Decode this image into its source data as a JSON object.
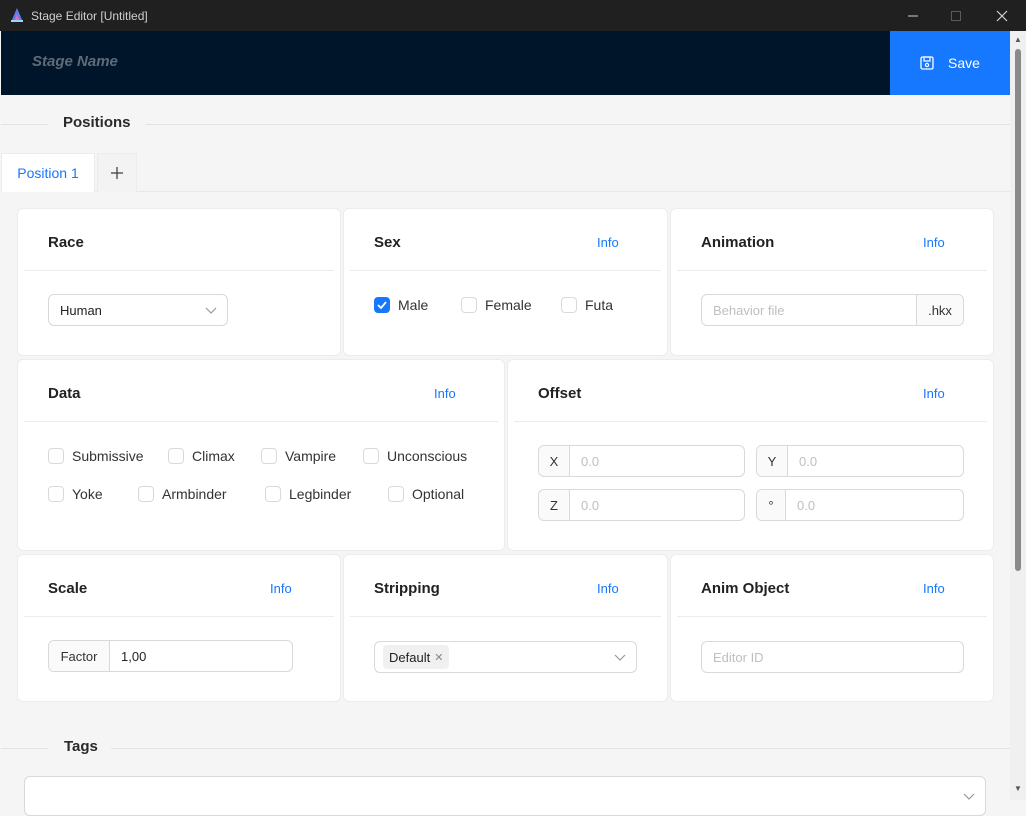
{
  "window": {
    "title": "Stage Editor [Untitled]",
    "minimize": "—",
    "maximize": "□",
    "close": "✕"
  },
  "header": {
    "stage_name": "Stage Name",
    "save_label": "Save"
  },
  "sections": {
    "positions": "Positions",
    "tags": "Tags"
  },
  "tabs": {
    "active": "Position 1",
    "add": "+"
  },
  "info_label": "Info",
  "race": {
    "title": "Race",
    "selected": "Human"
  },
  "sex": {
    "title": "Sex",
    "options": [
      {
        "label": "Male",
        "checked": true
      },
      {
        "label": "Female",
        "checked": false
      },
      {
        "label": "Futa",
        "checked": false
      }
    ]
  },
  "animation": {
    "title": "Animation",
    "placeholder": "Behavior file",
    "suffix": ".hkx"
  },
  "data": {
    "title": "Data",
    "options": [
      {
        "label": "Submissive",
        "checked": false
      },
      {
        "label": "Climax",
        "checked": false
      },
      {
        "label": "Vampire",
        "checked": false
      },
      {
        "label": "Unconscious",
        "checked": false
      },
      {
        "label": "Yoke",
        "checked": false
      },
      {
        "label": "Armbinder",
        "checked": false
      },
      {
        "label": "Legbinder",
        "checked": false
      },
      {
        "label": "Optional",
        "checked": false
      }
    ]
  },
  "offset": {
    "title": "Offset",
    "fields": [
      {
        "label": "X",
        "placeholder": "0.0"
      },
      {
        "label": "Y",
        "placeholder": "0.0"
      },
      {
        "label": "Z",
        "placeholder": "0.0"
      },
      {
        "label": "°",
        "placeholder": "0.0"
      }
    ]
  },
  "scale": {
    "title": "Scale",
    "addon": "Factor",
    "value": "1,00"
  },
  "stripping": {
    "title": "Stripping",
    "tag": "Default"
  },
  "anim_object": {
    "title": "Anim Object",
    "placeholder": "Editor ID"
  },
  "colors": {
    "accent": "#1677ff",
    "header_bg": "#001529",
    "titlebar_bg": "#202020"
  }
}
